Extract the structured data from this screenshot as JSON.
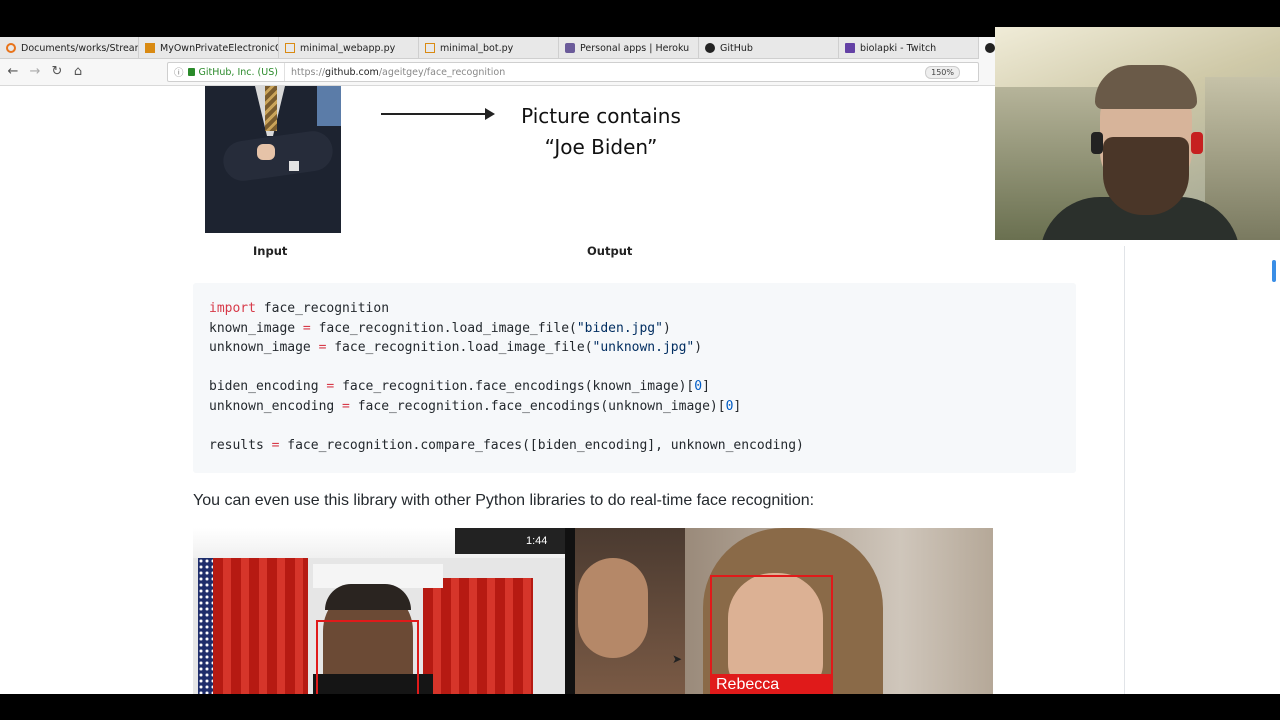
{
  "tabs": [
    {
      "label": "Documents/works/Stream",
      "icon": "document-icon",
      "color": "#e8731a"
    },
    {
      "label": "MyOwnPrivateElectronicGi",
      "icon": "folder-icon",
      "color": "#d98a12"
    },
    {
      "label": "minimal_webapp.py",
      "icon": "file-icon",
      "color": "#d98a12"
    },
    {
      "label": "minimal_bot.py",
      "icon": "file-icon",
      "color": "#d98a12"
    },
    {
      "label": "Personal apps | Heroku",
      "icon": "heroku-icon",
      "color": "#6b5b9a"
    },
    {
      "label": "GitHub",
      "icon": "github-icon",
      "color": "#222222"
    },
    {
      "label": "biolapki - Twitch",
      "icon": "twitch-icon",
      "color": "#6441a5"
    }
  ],
  "navbar": {
    "identity": "GitHub, Inc. (US)",
    "url_prefix": "https://",
    "url_host": "github.com",
    "url_path": "/ageitgey/face_recognition",
    "zoom": "150%"
  },
  "content": {
    "output_title_line1": "Picture contains",
    "output_title_line2": "“Joe Biden”",
    "caption_input": "Input",
    "caption_output": "Output",
    "code": {
      "l1_kw": "import",
      "l1_rest": " face_recognition",
      "l2_var": "known_image",
      "l2_op": " = ",
      "l2_call": "face_recognition.load_image_file(",
      "l2_str": "\"biden.jpg\"",
      "l2_end": ")",
      "l3_var": "unknown_image",
      "l3_op": " = ",
      "l3_call": "face_recognition.load_image_file(",
      "l3_str": "\"unknown.jpg\"",
      "l3_end": ")",
      "l5_var": "biden_encoding",
      "l5_op": " = ",
      "l5_call": "face_recognition.face_encodings(known_image)[",
      "l5_num": "0",
      "l5_end": "]",
      "l6_var": "unknown_encoding",
      "l6_op": " = ",
      "l6_call": "face_recognition.face_encodings(unknown_image)[",
      "l6_num": "0",
      "l6_end": "]",
      "l8_var": "results",
      "l8_op": " = ",
      "l8_call": "face_recognition.compare_faces([biden_encoding], unknown_encoding)"
    },
    "paragraph": "You can even use this library with other Python libraries to do real-time face recognition:",
    "phone_time": "1:44",
    "face_label": "Rebecca"
  }
}
